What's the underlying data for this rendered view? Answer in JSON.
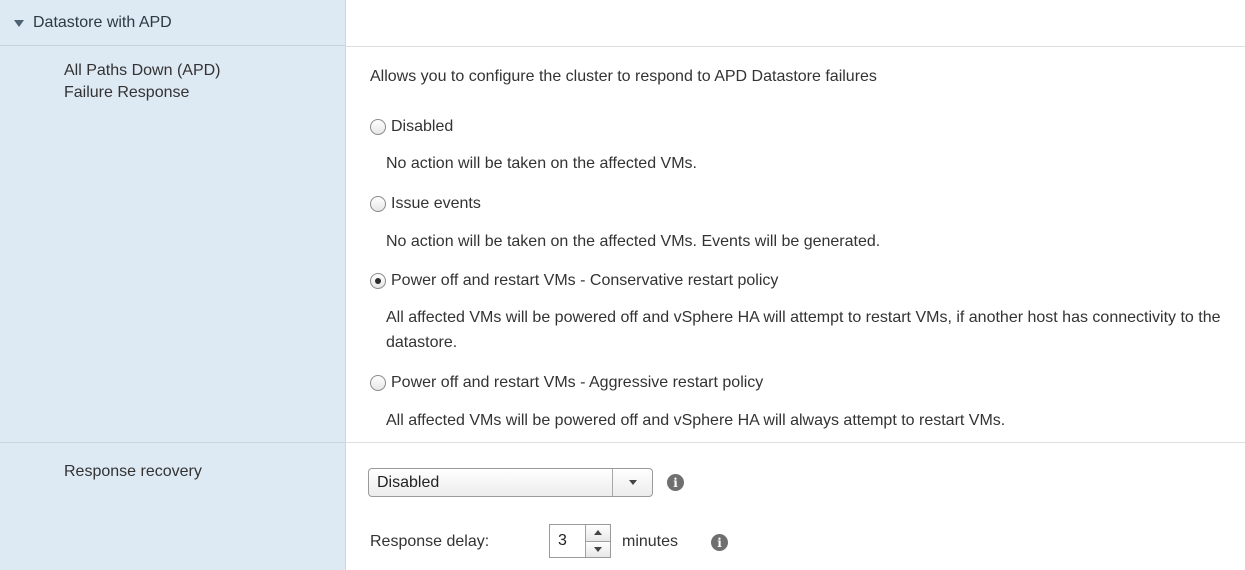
{
  "section": {
    "title": "Datastore with APD"
  },
  "apd": {
    "label_line1": "All Paths Down (APD)",
    "label_line2": "Failure Response",
    "description": "Allows you to configure the cluster to respond to APD Datastore failures",
    "options": [
      {
        "label": "Disabled",
        "desc": "No action will be taken on the affected VMs.",
        "checked": false
      },
      {
        "label": "Issue events",
        "desc": "No action will be taken on the affected VMs. Events will be generated.",
        "checked": false
      },
      {
        "label": "Power off and restart VMs - Conservative restart policy",
        "desc": "All affected VMs will be powered off and vSphere HA will attempt to restart VMs, if another host has connectivity to the datastore.",
        "checked": true
      },
      {
        "label": "Power off and restart VMs - Aggressive restart policy",
        "desc": "All affected VMs will be powered off and vSphere HA will always attempt to restart VMs.",
        "checked": false
      }
    ]
  },
  "recovery": {
    "label": "Response recovery",
    "select_value": "Disabled",
    "delay_label": "Response delay:",
    "delay_value": "3",
    "delay_units": "minutes"
  },
  "icons": {
    "expand": "chevron-down-icon",
    "info": "info-icon"
  },
  "colors": {
    "left_panel_bg": "#dde9f3"
  }
}
